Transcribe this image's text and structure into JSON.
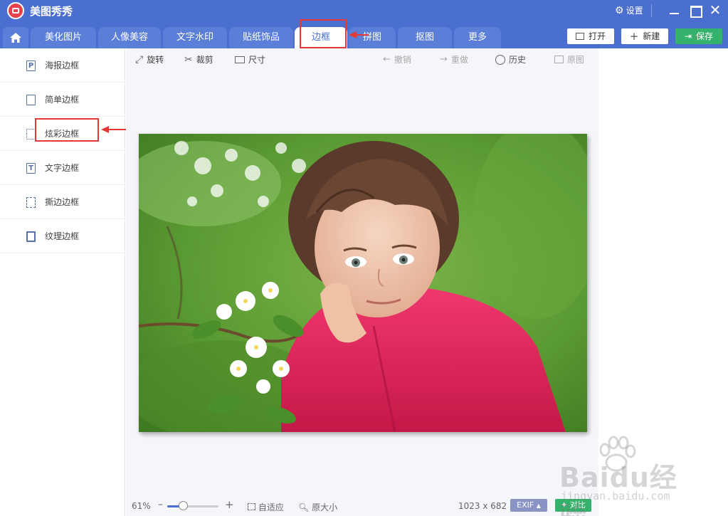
{
  "app": {
    "title": "美图秀秀",
    "settings_label": "设置"
  },
  "tabs": [
    {
      "label": "美化图片"
    },
    {
      "label": "人像美容"
    },
    {
      "label": "文字水印"
    },
    {
      "label": "贴纸饰品"
    },
    {
      "label": "边框",
      "active": true
    },
    {
      "label": "拼图"
    },
    {
      "label": "抠图"
    },
    {
      "label": "更多"
    }
  ],
  "top_buttons": {
    "open": "打开",
    "new": "新建",
    "save": "保存"
  },
  "sidebar": {
    "items": [
      {
        "label": "海报边框",
        "icon": "poster-frame-icon",
        "glyph": "P"
      },
      {
        "label": "简单边框",
        "icon": "simple-frame-icon",
        "glyph": ""
      },
      {
        "label": "炫彩边框",
        "icon": "colorful-frame-icon",
        "glyph": ""
      },
      {
        "label": "文字边框",
        "icon": "text-frame-icon",
        "glyph": "T"
      },
      {
        "label": "撕边边框",
        "icon": "torn-edge-frame-icon",
        "glyph": ""
      },
      {
        "label": "纹理边框",
        "icon": "texture-frame-icon",
        "glyph": ""
      }
    ]
  },
  "toolbar": {
    "rotate": "旋转",
    "crop": "裁剪",
    "size": "尺寸",
    "undo": "撤销",
    "redo": "重做",
    "history": "历史",
    "original": "原图"
  },
  "status": {
    "zoom": "61%",
    "zoom_level": 0.3,
    "fit": "自适应",
    "actual_size": "原大小",
    "dimensions": "1023 x 682",
    "exif": "EXIF",
    "compare": "对比"
  },
  "watermark": {
    "brand": "Baidu经验",
    "url": "jingyan.baidu.com"
  },
  "colors": {
    "accent": "#4b6fd1",
    "highlight": "#e53935",
    "save": "#34b26b"
  }
}
